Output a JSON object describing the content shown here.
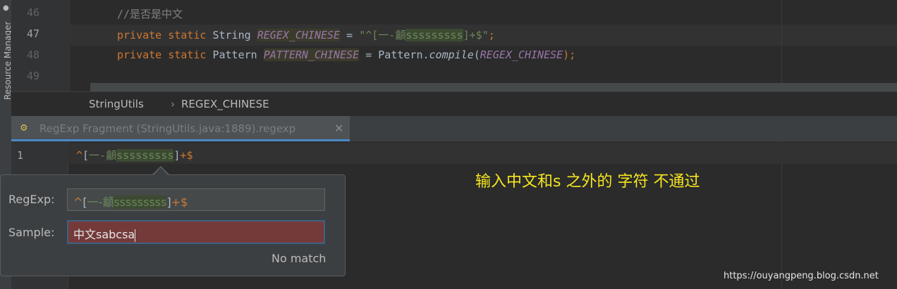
{
  "side_panel": {
    "label": "Resource Manager"
  },
  "editor": {
    "lines": [
      {
        "number": "46",
        "comment": "//是否是中文"
      },
      {
        "number": "47",
        "kw1": "private",
        "kw2": "static",
        "type": "String",
        "field": "REGEX_CHINESE",
        "eq": " = ",
        "str_pre": "\"^[一-",
        "str_hl": "龥",
        "str_s": "sssssssss",
        "str_post": "]+$\"",
        "end": ";"
      },
      {
        "number": "48",
        "kw1": "private",
        "kw2": "static",
        "type": "Pattern",
        "field": "PATTERN_CHINESE",
        "eq": " = ",
        "cls": "Pattern.",
        "method": "compile",
        "open": "(",
        "arg": "REGEX_CHINESE",
        "close": ");"
      },
      {
        "number": "49"
      }
    ]
  },
  "breadcrumb": {
    "class": "StringUtils",
    "separator": "›",
    "field": "REGEX_CHINESE"
  },
  "tab": {
    "label": "RegExp Fragment (StringUtils.java:1889).regexp",
    "close": "✕",
    "icon": "regexp-file-icon"
  },
  "fragment": {
    "line_number": "1",
    "caret": "^",
    "bracket_open": "[",
    "range": "一-",
    "cjk": "龥",
    "s_chars": "sssssssss",
    "bracket_close": "]",
    "plus": "+",
    "dollar": "$"
  },
  "popup": {
    "regexp_label": "RegExp:",
    "sample_label": "Sample:",
    "sample_value": "中文sabcsa",
    "status": "No match"
  },
  "annotation": "输入中文和s 之外的 字符  不通过",
  "watermark": "https://ouyangpeng.blog.csdn.net",
  "colors": {
    "keyword": "#cc7832",
    "string": "#6a8759",
    "field": "#9876aa",
    "comment": "#808080",
    "no_match_bg": "#743a3a",
    "annotation": "#f5e61f"
  }
}
